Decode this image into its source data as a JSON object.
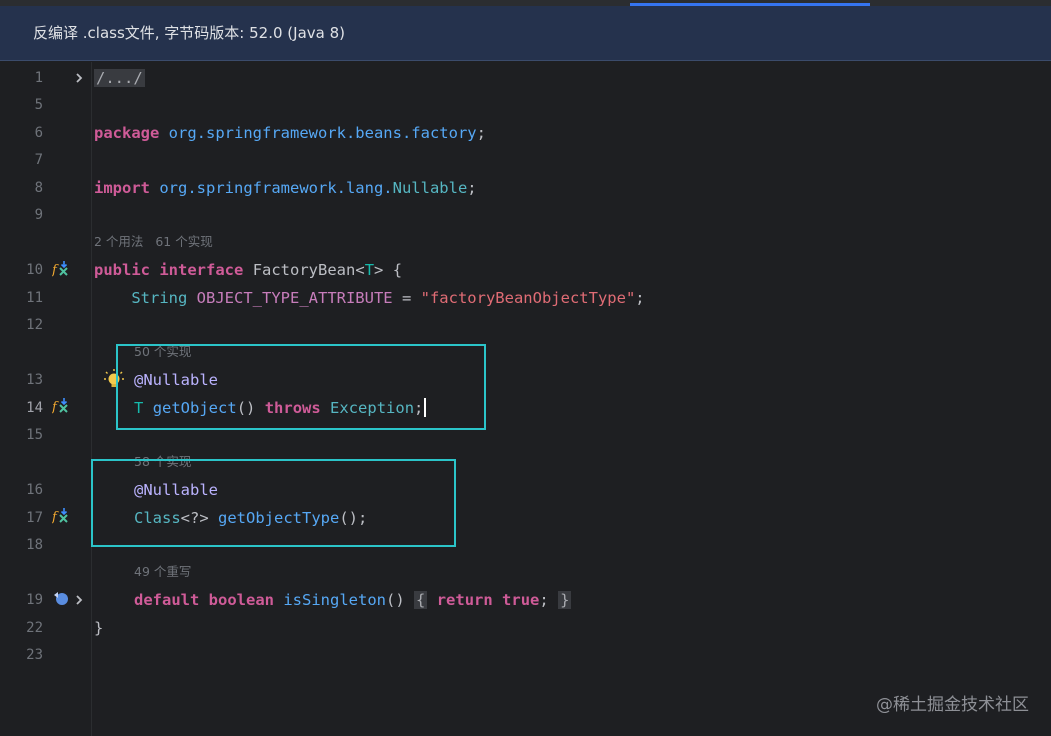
{
  "banner": {
    "text": "反编译 .class文件, 字节码版本: 52.0 (Java 8)"
  },
  "line_numbers": [
    "1",
    "5",
    "6",
    "7",
    "8",
    "9",
    "10",
    "11",
    "12",
    "13",
    "14",
    "15",
    "16",
    "17",
    "18",
    "19",
    "22",
    "23"
  ],
  "hints": {
    "interface_usages": "2 个用法   61 个实现",
    "getObject_impls": "50 个实现",
    "getObjectType_impls": "58 个实现",
    "isSingleton_overrides": "49 个重写"
  },
  "code": {
    "l1_fold": "/.../",
    "l6_kw": "package",
    "l6_pkg": "org.springframework.beans.factory",
    "l6_end": ";",
    "l8_kw": "import",
    "l8_pkg": "org.springframework.lang.",
    "l8_type": "Nullable",
    "l8_end": ";",
    "l10_kw1": "public",
    "l10_kw2": "interface",
    "l10_name": "FactoryBean",
    "l10_lt": "<",
    "l10_tp": "T",
    "l10_rest": "> {",
    "l11_type": "String",
    "l11_const": "OBJECT_TYPE_ATTRIBUTE",
    "l11_eq": " = ",
    "l11_str": "\"factoryBeanObjectType\"",
    "l11_end": ";",
    "l13_ann": "@Nullable",
    "l14_tp": "T",
    "l14_mth": "getObject",
    "l14_paren": "()",
    "l14_kw": "throws",
    "l14_type": "Exception",
    "l14_end": ";",
    "l16_ann": "@Nullable",
    "l17_type": "Class",
    "l17_gen": "<?>",
    "l17_mth": "getObjectType",
    "l17_end": "();",
    "l19_kw1": "default",
    "l19_kw2": "boolean",
    "l19_mth": "isSingleton",
    "l19_paren": "()",
    "l19_open": "{",
    "l19_kw3": "return",
    "l19_kw4": "true",
    "l19_semi": ";",
    "l19_close": "}",
    "l22": "}"
  },
  "watermark": "@稀土掘金技术社区",
  "colors": {
    "banner_bg": "#25324d",
    "editor_bg": "#1e1f22",
    "keyword": "#cf5b98",
    "highlight_box": "#2bc4c9"
  }
}
